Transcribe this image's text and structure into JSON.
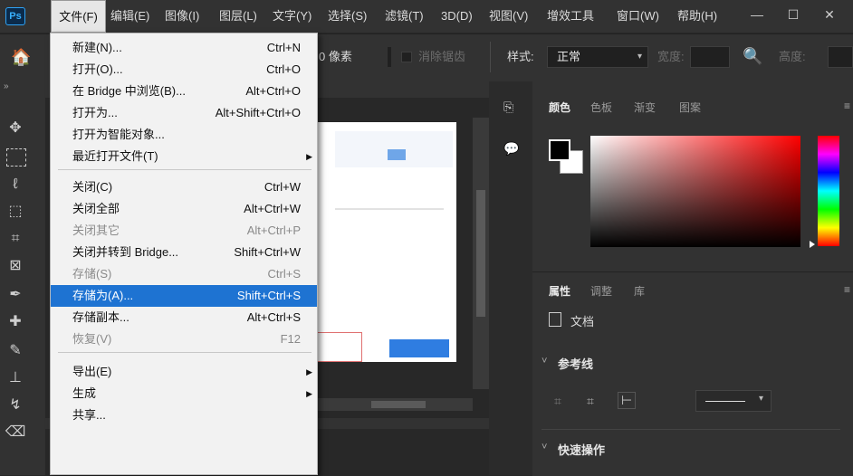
{
  "app": {
    "logo": "Ps"
  },
  "menubar": {
    "items": [
      "文件(F)",
      "编辑(E)",
      "图像(I)",
      "图层(L)",
      "文字(Y)",
      "选择(S)",
      "滤镜(T)",
      "3D(D)",
      "视图(V)",
      "增效工具",
      "窗口(W)",
      "帮助(H)"
    ]
  },
  "window_controls": {
    "minimize": "—",
    "maximize": "☐",
    "close": "✕"
  },
  "options_bar": {
    "feather_value": "0 像素",
    "antialias_label": "消除锯齿",
    "style_label": "样式:",
    "style_value": "正常",
    "width_label": "宽度:",
    "height_label": "高度:"
  },
  "file_menu": {
    "items": [
      {
        "label": "新建(N)...",
        "shortcut": "Ctrl+N",
        "disabled": false,
        "submenu": false
      },
      {
        "label": "打开(O)...",
        "shortcut": "Ctrl+O",
        "disabled": false,
        "submenu": false
      },
      {
        "label": "在 Bridge 中浏览(B)...",
        "shortcut": "Alt+Ctrl+O",
        "disabled": false,
        "submenu": false
      },
      {
        "label": "打开为...",
        "shortcut": "Alt+Shift+Ctrl+O",
        "disabled": false,
        "submenu": false
      },
      {
        "label": "打开为智能对象...",
        "shortcut": "",
        "disabled": false,
        "submenu": false
      },
      {
        "label": "最近打开文件(T)",
        "shortcut": "",
        "disabled": false,
        "submenu": true
      },
      {
        "label": "关闭(C)",
        "shortcut": "Ctrl+W",
        "disabled": false,
        "submenu": false
      },
      {
        "label": "关闭全部",
        "shortcut": "Alt+Ctrl+W",
        "disabled": false,
        "submenu": false
      },
      {
        "label": "关闭其它",
        "shortcut": "Alt+Ctrl+P",
        "disabled": true,
        "submenu": false
      },
      {
        "label": "关闭并转到 Bridge...",
        "shortcut": "Shift+Ctrl+W",
        "disabled": false,
        "submenu": false
      },
      {
        "label": "存储(S)",
        "shortcut": "Ctrl+S",
        "disabled": true,
        "submenu": false
      },
      {
        "label": "存储为(A)...",
        "shortcut": "Shift+Ctrl+S",
        "disabled": false,
        "submenu": false,
        "highlighted": true
      },
      {
        "label": "存储副本...",
        "shortcut": "Alt+Ctrl+S",
        "disabled": false,
        "submenu": false
      },
      {
        "label": "恢复(V)",
        "shortcut": "F12",
        "disabled": true,
        "submenu": false
      },
      {
        "label": "导出(E)",
        "shortcut": "",
        "disabled": false,
        "submenu": true
      },
      {
        "label": "生成",
        "shortcut": "",
        "disabled": false,
        "submenu": true
      },
      {
        "label": "共享...",
        "shortcut": "",
        "disabled": false,
        "submenu": false
      }
    ]
  },
  "color_panel": {
    "tabs": [
      "颜色",
      "色板",
      "渐变",
      "图案"
    ],
    "active_tab": "颜色",
    "foreground": "#000000",
    "background": "#ffffff",
    "hue_base": "#ff0000"
  },
  "properties_panel": {
    "tabs": [
      "属性",
      "调整",
      "库"
    ],
    "active_tab": "属性",
    "doc_label": "文档",
    "guides_section": "参考线",
    "quick_actions_section": "快速操作"
  },
  "colors": {
    "accent": "#1e73d2",
    "menu_bg": "#f2f2f2",
    "ui_dark": "#323232"
  }
}
